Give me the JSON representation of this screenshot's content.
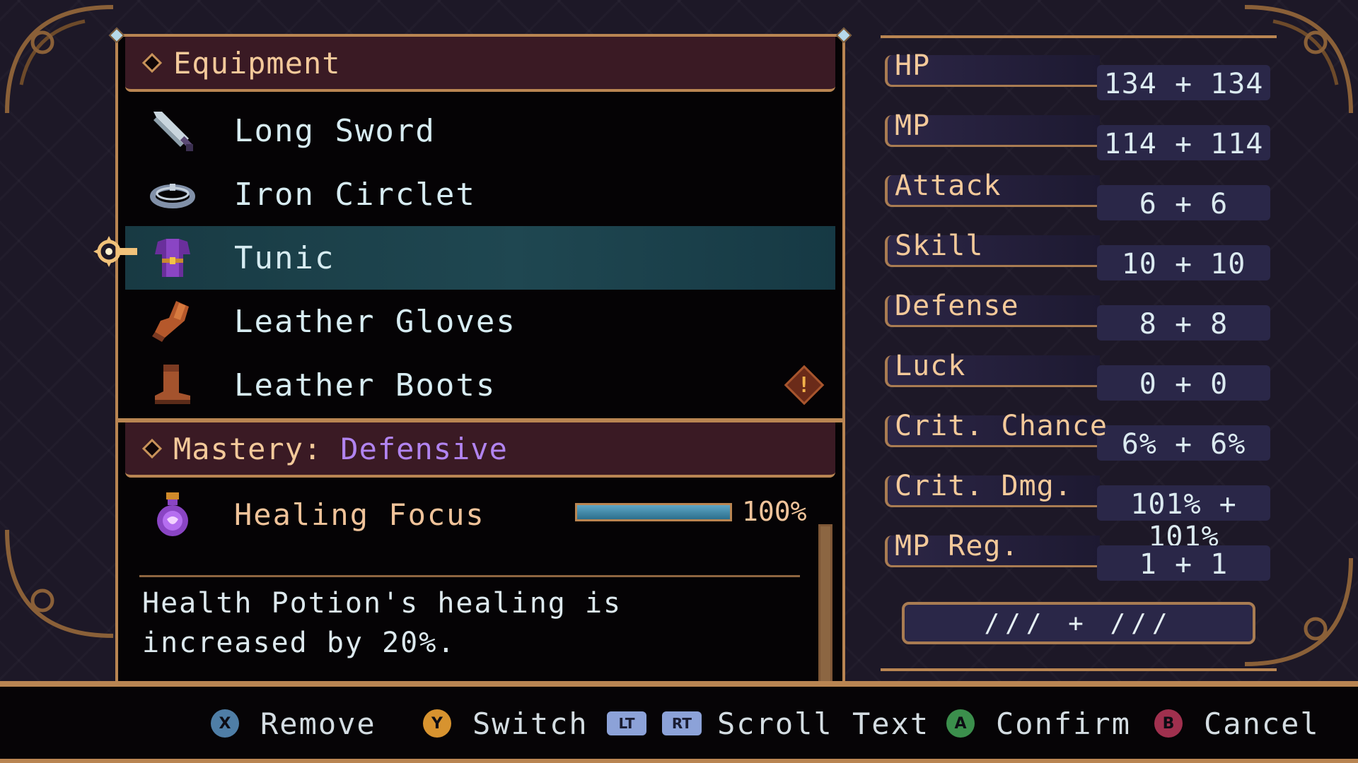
{
  "equipment": {
    "title": "Equipment",
    "items": [
      {
        "label": "Long Sword",
        "icon": "sword-icon"
      },
      {
        "label": "Iron Circlet",
        "icon": "circlet-icon"
      },
      {
        "label": "Tunic",
        "icon": "tunic-icon",
        "selected": true
      },
      {
        "label": "Leather Gloves",
        "icon": "gloves-icon"
      },
      {
        "label": "Leather Boots",
        "icon": "boots-icon",
        "alert": "!"
      }
    ]
  },
  "mastery": {
    "title": "Mastery:",
    "type": "Defensive",
    "skill_name": "Healing Focus",
    "progress": 1.0,
    "progress_text": "100%",
    "description": "Health Potion's healing is increased by 20%."
  },
  "stats": [
    {
      "label": "HP",
      "value": "134 + 134"
    },
    {
      "label": "MP",
      "value": "114 + 114"
    },
    {
      "label": "Attack",
      "value": "6 + 6"
    },
    {
      "label": "Skill",
      "value": "10 + 10"
    },
    {
      "label": "Defense",
      "value": "8 + 8"
    },
    {
      "label": "Luck",
      "value": "0 + 0"
    },
    {
      "label": "Crit. Chance",
      "value": "6% + 6%"
    },
    {
      "label": "Crit. Dmg.",
      "value": "101% + 101%"
    },
    {
      "label": "MP Reg.",
      "value": "1 + 1"
    }
  ],
  "slot_bar": {
    "value": "/// + ///"
  },
  "controls": [
    {
      "button": "X",
      "label": "Remove",
      "color": "#4f7ea6"
    },
    {
      "button": "Y",
      "label": "Switch",
      "color": "#d7932f"
    },
    {
      "button": "LT",
      "button2": "RT",
      "label": "Scroll Text",
      "color": "#8ca2d8"
    },
    {
      "button": "A",
      "label": "Confirm",
      "color": "#3b8f4c"
    },
    {
      "button": "B",
      "label": "Cancel",
      "color": "#a0304e"
    }
  ],
  "colors": {
    "accent_gold": "#b98552",
    "selected_row": "#1f4751",
    "mastery_purple": "#b184f0",
    "progress_blue": "#5ea6c6"
  }
}
